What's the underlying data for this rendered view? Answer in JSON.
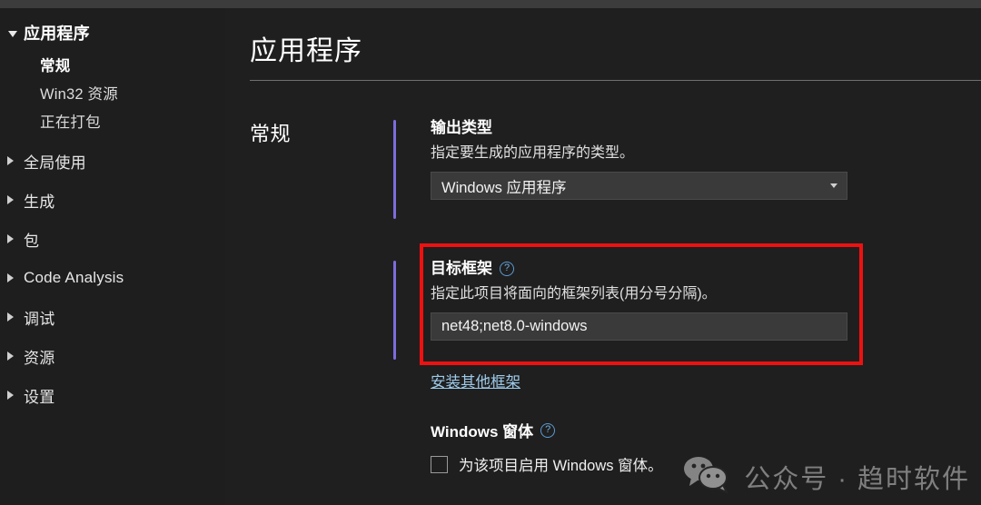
{
  "sidebar": {
    "items": [
      {
        "label": "应用程序",
        "icon": "triangle-down-icon",
        "level": "root",
        "expanded": true,
        "selected": false
      },
      {
        "label": "常规",
        "icon": "",
        "level": "child",
        "expanded": false,
        "selected": true
      },
      {
        "label": "Win32 资源",
        "icon": "",
        "level": "child",
        "expanded": false,
        "selected": false
      },
      {
        "label": "正在打包",
        "icon": "",
        "level": "child",
        "expanded": false,
        "selected": false
      },
      {
        "label": "全局使用",
        "icon": "triangle-right-icon",
        "level": "top",
        "expanded": false,
        "selected": false
      },
      {
        "label": "生成",
        "icon": "triangle-right-icon",
        "level": "top",
        "expanded": false,
        "selected": false
      },
      {
        "label": "包",
        "icon": "triangle-right-icon",
        "level": "top",
        "expanded": false,
        "selected": false
      },
      {
        "label": "Code Analysis",
        "icon": "triangle-right-icon",
        "level": "top",
        "expanded": false,
        "selected": false
      },
      {
        "label": "调试",
        "icon": "triangle-right-icon",
        "level": "top",
        "expanded": false,
        "selected": false
      },
      {
        "label": "资源",
        "icon": "triangle-right-icon",
        "level": "top",
        "expanded": false,
        "selected": false
      },
      {
        "label": "设置",
        "icon": "triangle-right-icon",
        "level": "top",
        "expanded": false,
        "selected": false
      }
    ]
  },
  "main": {
    "page_title": "应用程序",
    "section_label": "常规",
    "output_type": {
      "title": "输出类型",
      "description": "指定要生成的应用程序的类型。",
      "value": "Windows 应用程序",
      "caret_icon": "chevron-down-icon"
    },
    "target_framework": {
      "title": "目标框架",
      "help_icon": "question-mark-icon",
      "help_glyph": "?",
      "description": "指定此项目将面向的框架列表(用分号分隔)。",
      "value": "net48;net8.0-windows",
      "placeholder": "",
      "highlighted": true
    },
    "install_link": "安装其他框架",
    "winforms": {
      "title": "Windows 窗体",
      "help_icon": "question-mark-icon",
      "help_glyph": "?",
      "checkbox_label": "为该项目启用 Windows 窗体。",
      "checked": false
    }
  },
  "watermark": {
    "icon": "wechat-icon",
    "text": "公众号 · 趋时软件"
  },
  "colors": {
    "background": "#1f1f1f",
    "sidebar_background": "#1e1e1e",
    "accent_bar": "#7d6cdc",
    "highlight_border": "#ee1111",
    "link": "#9dcaea",
    "input_background": "#3a3a3a",
    "help_icon": "#5b9bd5"
  }
}
